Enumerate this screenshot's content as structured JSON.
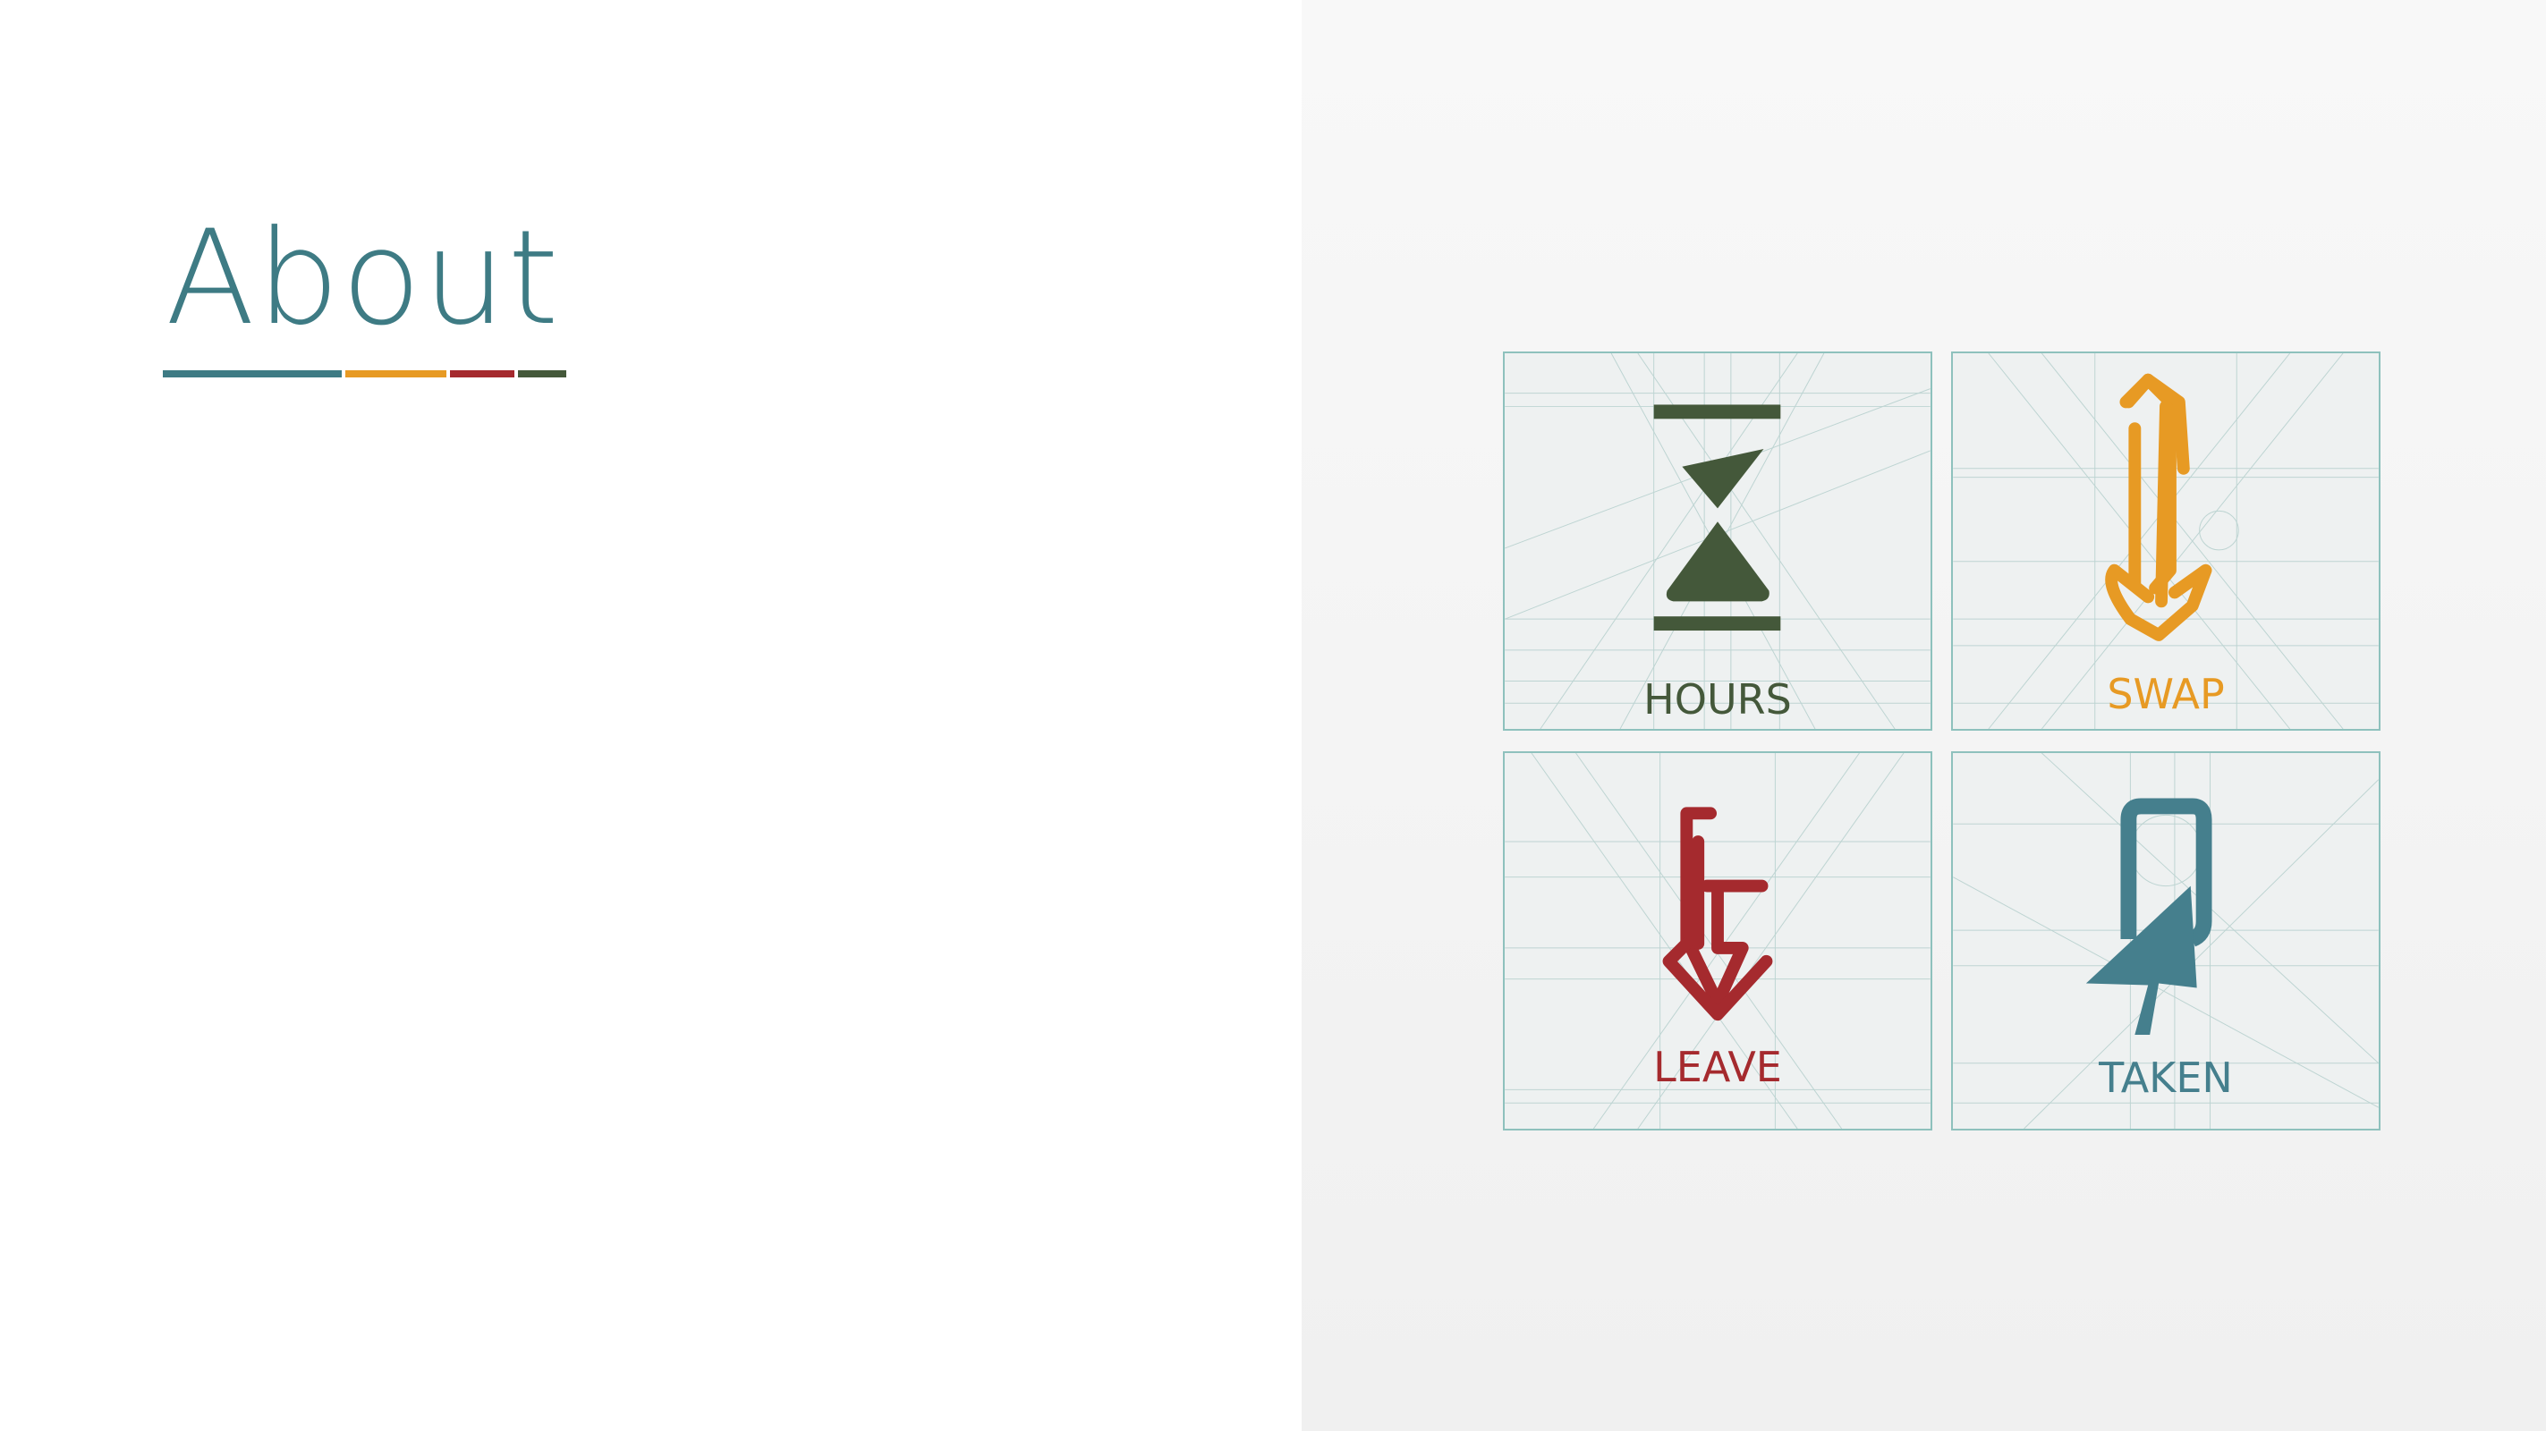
{
  "title": "About",
  "colors": {
    "teal": "#3e7b84",
    "orange": "#e79a24",
    "red": "#a52a2e",
    "green": "#44583a"
  },
  "icons": [
    {
      "label": "HOURS",
      "icon": "hourglass-icon",
      "color": "#44583a"
    },
    {
      "label": "SWAP",
      "icon": "swap-arrows-icon",
      "color": "#e79a24"
    },
    {
      "label": "LEAVE",
      "icon": "leave-arrow-icon",
      "color": "#a52a2e"
    },
    {
      "label": "TAKEN",
      "icon": "cursor-taken-icon",
      "color": "#457f8d"
    }
  ]
}
